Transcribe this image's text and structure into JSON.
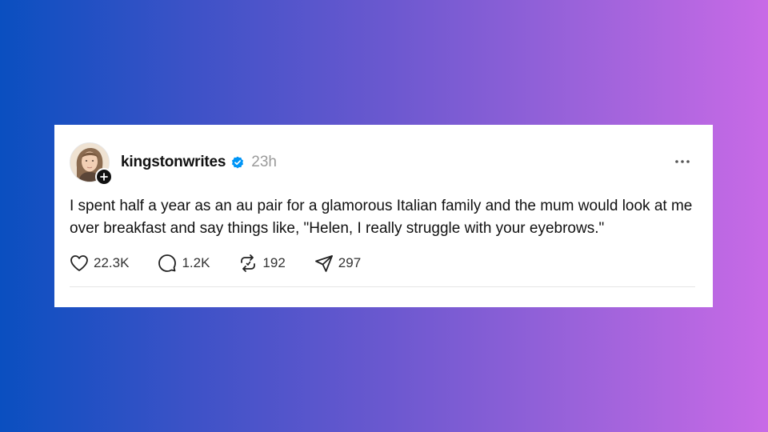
{
  "post": {
    "username": "kingstonwrites",
    "timestamp": "23h",
    "text": "I spent half a year as an au pair for a glamorous Italian family and the mum would look at me over breakfast and say things like, \"Helen, I really struggle with your eyebrows.\"",
    "verified": true,
    "avatar_icon": "user-avatar",
    "follow_icon": "plus-icon",
    "more_icon": "more-horizontal-icon"
  },
  "actions": {
    "likes": "22.3K",
    "replies": "1.2K",
    "reposts": "192",
    "shares": "297"
  },
  "colors": {
    "verified_blue": "#0095f6",
    "text": "#111111",
    "muted": "#9a9a9a"
  }
}
